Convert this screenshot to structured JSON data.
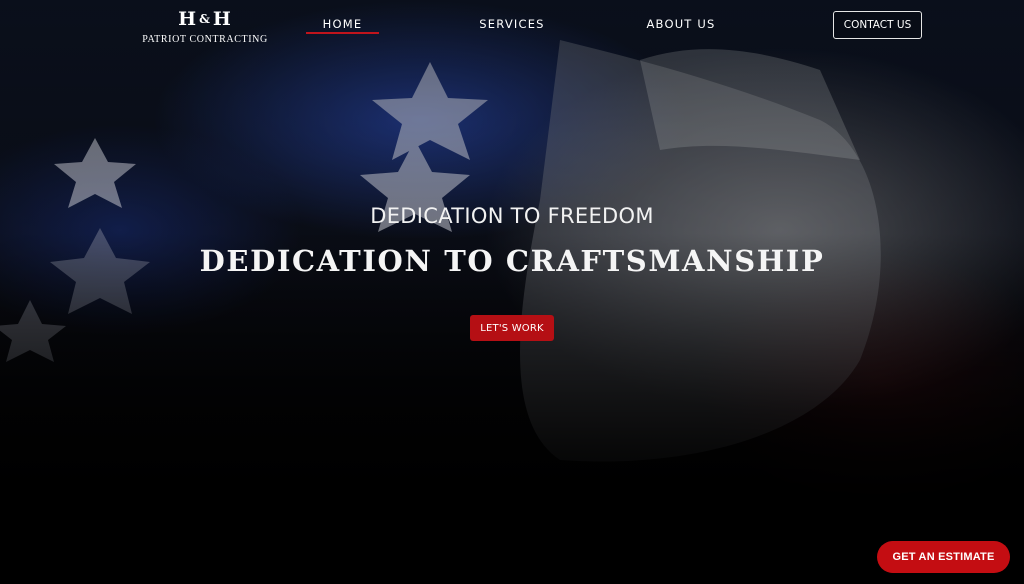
{
  "header": {
    "logo_mark_left": "H",
    "logo_mark_amp": "&",
    "logo_mark_right": "H",
    "logo_subtitle": "PATRIOT CONTRACTING",
    "nav": {
      "home": "HOME",
      "services": "SERVICES",
      "about": "ABOUT US"
    },
    "active_nav": "HOME",
    "contact_label": "CONTACT US"
  },
  "hero": {
    "tagline": "DEDICATION TO FREEDOM",
    "headline": "DEDICATION TO CRAFTSMANSHIP",
    "cta_label": "LET'S WORK",
    "background_icon": "american-flag-image"
  },
  "floating": {
    "estimate_label": "GET AN ESTIMATE"
  },
  "colors": {
    "accent_red": "#b50f14",
    "text_white": "#ffffff",
    "background": "#000000"
  }
}
